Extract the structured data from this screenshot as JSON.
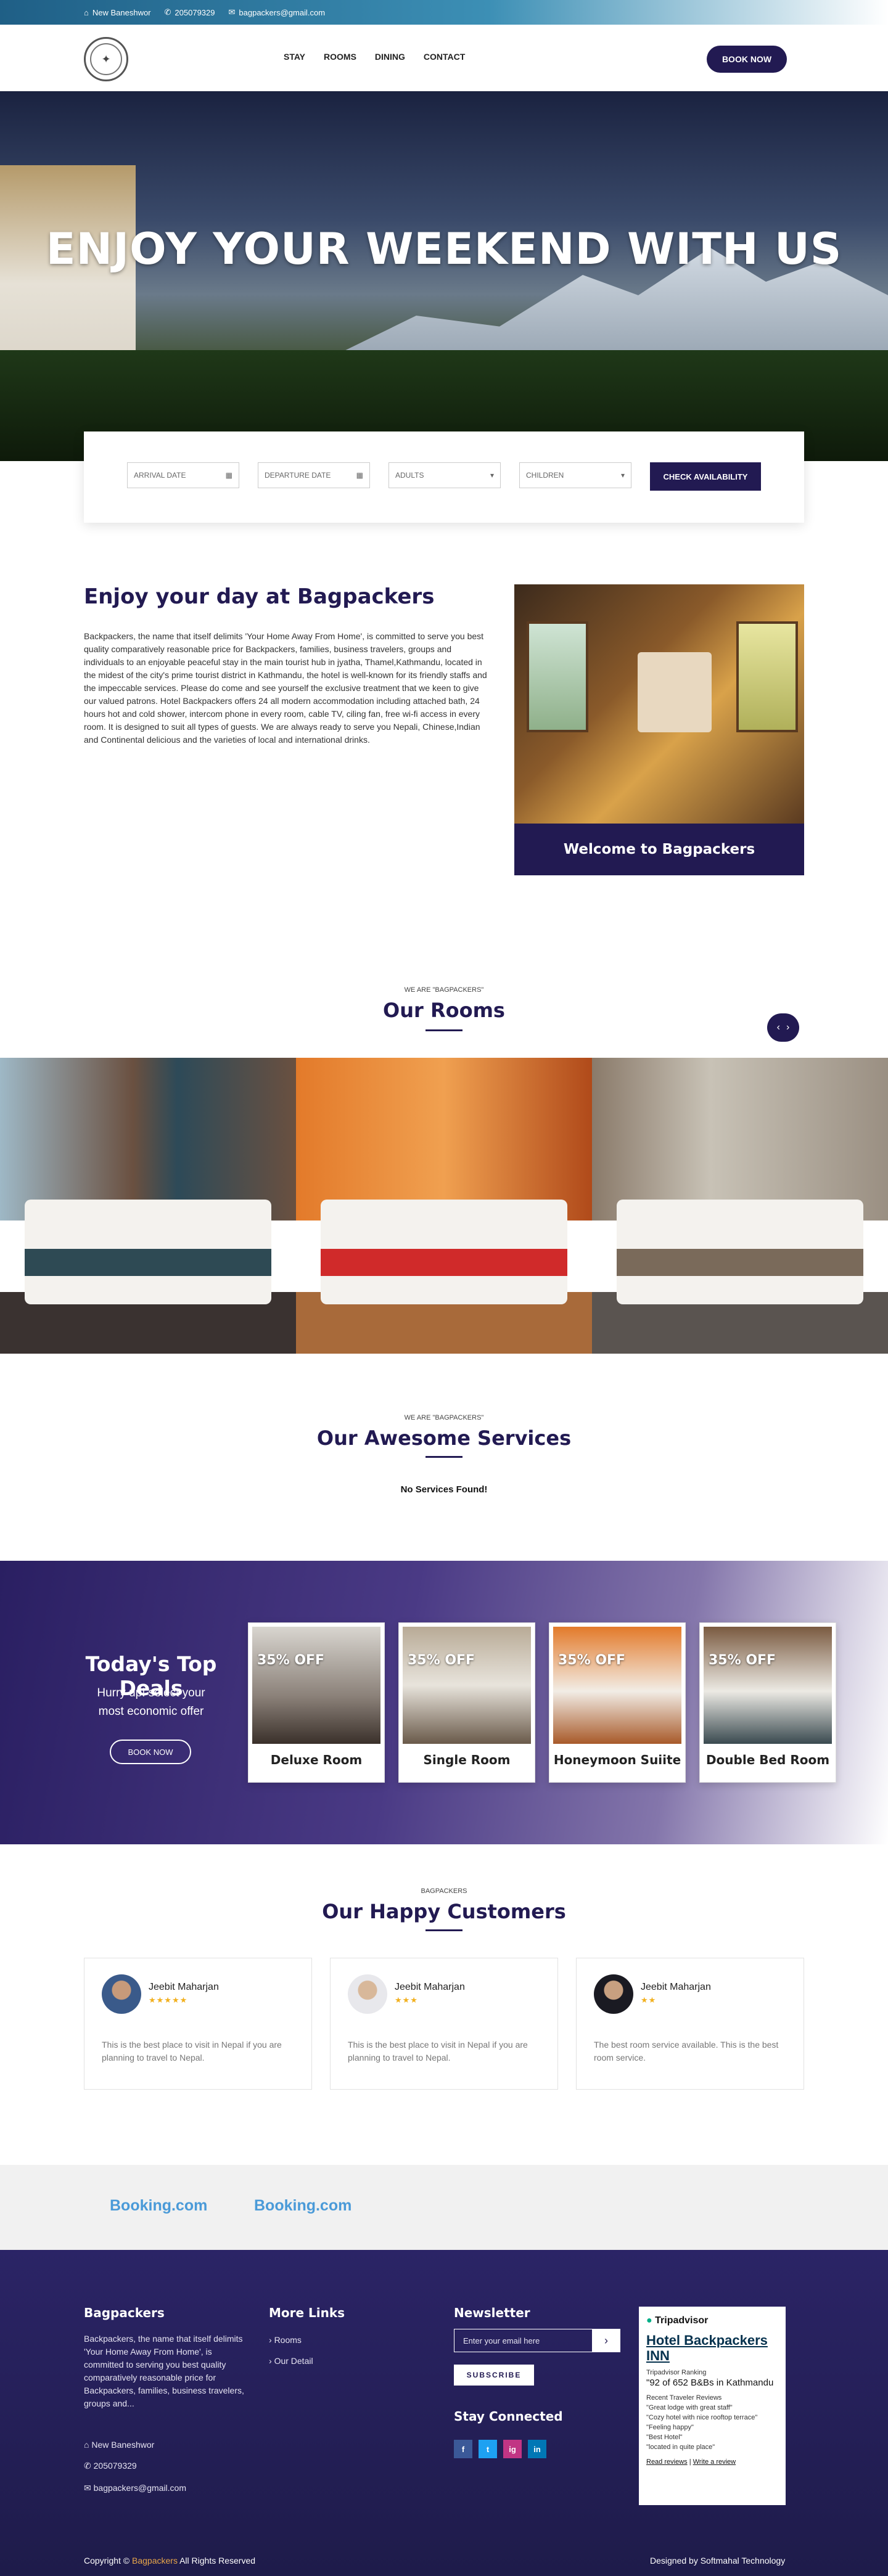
{
  "topbar": {
    "location": "New Baneshwor",
    "phone": "205079329",
    "email": "bagpackers@gmail.com"
  },
  "nav": {
    "items": [
      "STAY",
      "ROOMS",
      "DINING",
      "CONTACT"
    ],
    "book_now": "BOOK NOW"
  },
  "hero": {
    "title": "ENJOY YOUR WEEKEND WITH US"
  },
  "availability": {
    "arrival_placeholder": "ARRIVAL DATE",
    "departure_placeholder": "DEPARTURE DATE",
    "adults": "ADULTS",
    "children": "CHILDREN",
    "button": "CHECK AVAILABILITY"
  },
  "about": {
    "title": "Enjoy your day at Bagpackers",
    "text": "Backpackers, the name that itself delimits 'Your Home Away From Home', is committed to serve you best quality comparatively reasonable price for Backpackers, families, business travelers, groups and individuals to an enjoyable peaceful stay in the main tourist hub in jyatha, Thamel,Kathmandu, located in the midest of the city's prime tourist district in Kathmandu, the hotel is well-known for its friendly staffs and the impeccable services. Please do come and see yourself the exclusive treatment that we keen to give our valued patrons. Hotel Backpackers offers 24 all modern accommodation including attached bath, 24 hours hot and cold shower, intercom phone in every room, cable TV, ciling fan, free wi-fi access in every room. It is designed to suit all types of guests. We are always ready to serve you Nepali, Chinese,Indian and Continental delicious and the varieties of local and international drinks.",
    "caption": "Welcome to Bagpackers"
  },
  "rooms": {
    "subtitle": "WE ARE \"BAGPACKERS\"",
    "title": "Our Rooms"
  },
  "services": {
    "subtitle": "WE ARE \"BAGPACKERS\"",
    "title": "Our Awesome Services",
    "empty": "No Services Found!"
  },
  "deals": {
    "title": "Today's Top Deals",
    "text_line1": "Hurry up! select your",
    "text_line2": "most economic offer",
    "button": "BOOK NOW",
    "cards": [
      {
        "discount": "35% OFF",
        "name": "Deluxe Room"
      },
      {
        "discount": "35% OFF",
        "name": "Single Room"
      },
      {
        "discount": "35% OFF",
        "name": "Honeymoon Suiite"
      },
      {
        "discount": "35% OFF",
        "name": "Double Bed Room"
      }
    ]
  },
  "customers": {
    "subtitle": "BAGPACKERS",
    "title": "Our Happy Customers",
    "items": [
      {
        "name": "Jeebit Maharjan",
        "stars": "★★★★★",
        "text": "This is the best place to visit in Nepal if you are planning to travel to Nepal."
      },
      {
        "name": "Jeebit Maharjan",
        "stars": "★★★",
        "text": "This is the best place to visit in Nepal if you are planning to travel to Nepal."
      },
      {
        "name": "Jeebit Maharjan",
        "stars": "★★",
        "text": "The best room service available. This is the best room service."
      }
    ]
  },
  "partners": {
    "logo1": "Booking.com",
    "logo2": "Booking.com"
  },
  "footer": {
    "about_title": "Bagpackers",
    "about_text": "Backpackers, the name that itself delimits 'Your Home Away From Home', is committed to serving you best quality comparatively reasonable price for Backpackers, families, business travelers, groups and...",
    "location": "New Baneshwor",
    "phone": "205079329",
    "email": "bagpackers@gmail.com",
    "links_title": "More Links",
    "links": [
      "Rooms",
      "Our Detail"
    ],
    "newsletter_title": "Newsletter",
    "email_placeholder": "Enter your email here",
    "subscribe": "SUBSCRIBE",
    "social_title": "Stay Connected",
    "social": [
      "f",
      "t",
      "ig",
      "in"
    ],
    "tripadvisor": {
      "brand": "Tripadvisor",
      "hotel": "Hotel Backpackers INN",
      "ranking_label": "Tripadvisor Ranking",
      "ranking": "\"92 of 652 B&Bs in Kathmandu",
      "reviews_label": "Recent Traveler Reviews",
      "reviews": [
        "\"Great lodge with great staff\"",
        "\"Cozy hotel with nice rooftop terrace\"",
        "\"Feeling happy\"",
        "\"Best Hotel\"",
        "\"located in quite place\""
      ],
      "read_reviews": "Read reviews",
      "write_review": "Write a review"
    },
    "copyright_prefix": "Copyright ©",
    "copyright_brand": "Bagpackers",
    "copyright_suffix": "All Rights Reserved",
    "designed_by": "Designed by Softmahal Technology"
  },
  "colors": {
    "primary": "#221a52",
    "accent": "#f2b01e"
  }
}
